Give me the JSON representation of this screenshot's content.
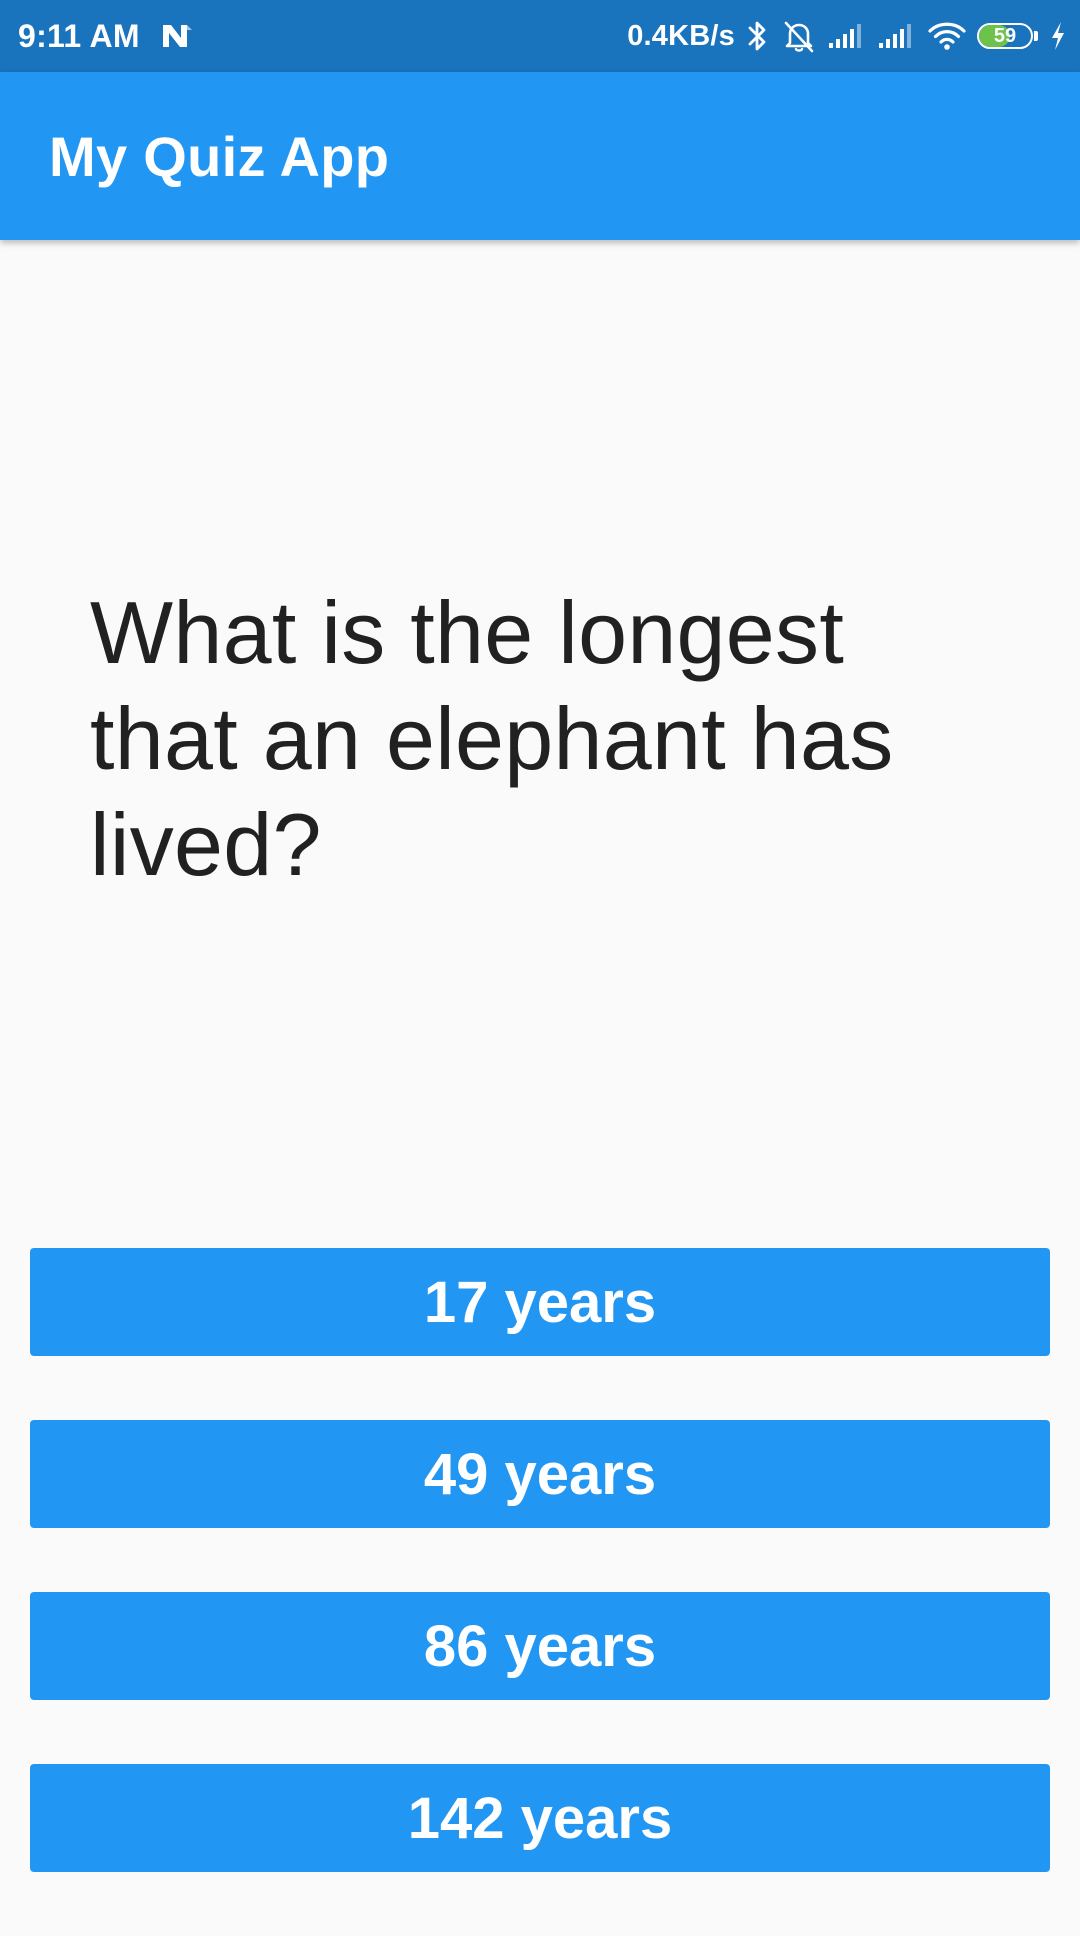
{
  "status_bar": {
    "time": "9:11 AM",
    "net_speed": "0.4KB/s",
    "battery_percent": "59",
    "battery_level": 0.59,
    "icons": [
      "n-notification-icon",
      "bluetooth-icon",
      "bell-muted-icon",
      "signal-icon",
      "signal-icon",
      "wifi-icon",
      "battery-icon",
      "charging-icon"
    ],
    "colors": {
      "background": "#1a73bd",
      "battery_fill": "#6cc24a"
    }
  },
  "app_bar": {
    "title": "My Quiz App",
    "color": "#2196f3"
  },
  "question": {
    "text": "What is the longest that an elephant has lived?"
  },
  "answers": [
    {
      "label": "17 years"
    },
    {
      "label": "49 years"
    },
    {
      "label": "86 years"
    },
    {
      "label": "142 years"
    }
  ]
}
